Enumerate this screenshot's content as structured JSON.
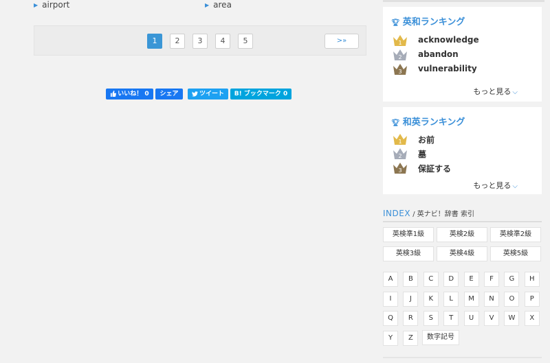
{
  "words": [
    {
      "label": "airport"
    },
    {
      "label": "area"
    }
  ],
  "pagination": {
    "pages": [
      "1",
      "2",
      "3",
      "4",
      "5"
    ],
    "active": "1",
    "last_label": ">»"
  },
  "share": {
    "like_label": "いいね！ 0",
    "share_label": "シェア",
    "tweet_label": "ツイート",
    "hatena_label": "B! ブックマーク 0"
  },
  "ranking_en": {
    "title": "英和ランキング",
    "items": [
      {
        "rank": "1",
        "word": "acknowledge"
      },
      {
        "rank": "2",
        "word": "abandon"
      },
      {
        "rank": "3",
        "word": "vulnerability"
      }
    ],
    "more_label": "もっと見る"
  },
  "ranking_ja": {
    "title": "和英ランキング",
    "items": [
      {
        "rank": "1",
        "word": "お前"
      },
      {
        "rank": "2",
        "word": "墓"
      },
      {
        "rank": "3",
        "word": "保証する"
      }
    ],
    "more_label": "もっと見る"
  },
  "index": {
    "title": "INDEX",
    "subtitle": " / 英ナビ！辞書 索引",
    "grades": [
      "英検準1級",
      "英検2級",
      "英検準2級",
      "英検3級",
      "英検4級",
      "英検5級"
    ],
    "letters": [
      "A",
      "B",
      "C",
      "D",
      "E",
      "F",
      "G",
      "H",
      "I",
      "J",
      "K",
      "L",
      "M",
      "N",
      "O",
      "P",
      "Q",
      "R",
      "S",
      "T",
      "U",
      "V",
      "W",
      "X",
      "Y",
      "Z"
    ],
    "numsym_label": "数字記号"
  },
  "colors": {
    "accent": "#3a96d6",
    "gold": "#e2b94a",
    "silver": "#a6acb8",
    "bronze": "#8c7651"
  }
}
